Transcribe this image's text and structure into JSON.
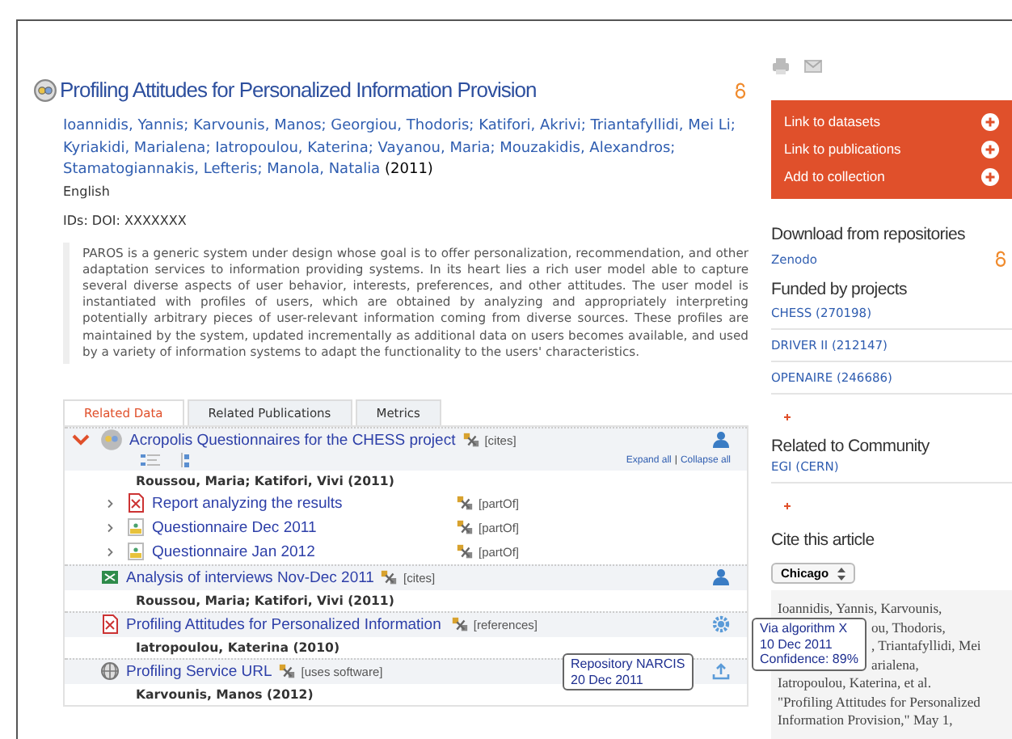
{
  "title": "Profiling Attitudes for Personalized Information Provision",
  "authors": "Ioannidis, Yannis; Karvounis, Manos; Georgiou, Thodoris; Katifori, Akrivi; Triantafyllidi, Mei Li; Kyriakidi, Marialena; Iatropoulou, Katerina; Vayanou, Maria; Mouzakidis, Alexandros; Stamatogiannakis, Lefteris; Manola, Natalia",
  "year": "(2011)",
  "language": "English",
  "ids": "IDs: DOI: XXXXXXX",
  "abstract": "PAROS is a generic system under design whose goal is to offer personalization, recommendation, and other adaptation services to information providing systems. In its heart lies a rich user model able to capture several diverse aspects of user behavior, interests, preferences, and other attitudes. The user model is instantiated with profiles of users, which are obtained by analyzing and appropriately interpreting potentially arbitrary pieces of user-relevant information coming from diverse sources. These profiles are maintained by the system, updated incrementally as additional data on users becomes available, and used by a variety of information systems to adapt the functionality to the users' characteristics.",
  "tabs": [
    {
      "label": "Related Data",
      "selected": true
    },
    {
      "label": "Related Publications",
      "selected": false
    },
    {
      "label": "Metrics",
      "selected": false
    }
  ],
  "related": {
    "expand_all": "Expand all",
    "separator": "|",
    "collapse_all": "Collapse all",
    "rows": [
      {
        "kind": "dataset",
        "expanded": true,
        "title": "Acropolis Questionnaires for the CHESS project",
        "relation": "[cites]",
        "action": {
          "kind": "user"
        },
        "view_icons": true,
        "authors": "Roussou, Maria; Katifori, Vivi (2011)",
        "children": [
          {
            "kind": "pdf",
            "expanded": false,
            "title": "Report analyzing the results",
            "relation": "[partOf]"
          },
          {
            "kind": "image",
            "expanded": false,
            "title": "Questionnaire Dec 2011",
            "relation": "[partOf]"
          },
          {
            "kind": "image",
            "expanded": false,
            "title": "Questionnaire Jan 2012",
            "relation": "[partOf]"
          }
        ]
      },
      {
        "kind": "spreadsheet",
        "title": "Analysis of interviews Nov-Dec 2011",
        "relation": "[cites]",
        "action": {
          "kind": "user"
        },
        "authors": "Roussou, Maria; Katifori, Vivi (2011)"
      },
      {
        "kind": "pdf",
        "title": "Profiling Attitudes for Personalized Information",
        "relation": "[references]",
        "action": {
          "kind": "gear"
        },
        "authors": "Iatropoulou, Katerina (2010)",
        "tooltip": [
          "Via algorithm X",
          "10 Dec 2011",
          "Confidence: 89%"
        ]
      },
      {
        "kind": "web",
        "title": "Profiling Service URL",
        "relation": "[uses software]",
        "action": {
          "kind": "upload"
        },
        "authors": "Karvounis, Manos (2012)",
        "tooltip": [
          "Repository NARCIS",
          "20 Dec 2011"
        ]
      }
    ]
  },
  "sidebar": {
    "actions": [
      "Link to datasets",
      "Link to publications",
      "Add to collection"
    ],
    "download": {
      "heading": "Download from repositories",
      "items": [
        "Zenodo"
      ]
    },
    "funding": {
      "heading": "Funded by projects",
      "items": [
        "CHESS (270198)",
        "DRIVER II (212147)",
        "OPENAIRE (246686)"
      ]
    },
    "community": {
      "heading": "Related to Community",
      "items": [
        "EGI (CERN)"
      ]
    },
    "cite": {
      "heading": "Cite this article",
      "style": "Chicago",
      "lines": [
        {
          "kind": "full",
          "text": "Ioannidis, Yannis, Karvounis,"
        },
        {
          "kind": "partial",
          "text": "ou, Thodoris,"
        },
        {
          "kind": "partial",
          "text": ", Triantafyllidi, Mei"
        },
        {
          "kind": "partial",
          "text": "arialena,"
        },
        {
          "kind": "full",
          "text": "Iatropoulou, Katerina, et al."
        },
        {
          "kind": "full",
          "text": "\"Profiling Attitudes for Personalized"
        },
        {
          "kind": "full",
          "text": "Information Provision,\" May 1,"
        }
      ]
    }
  }
}
